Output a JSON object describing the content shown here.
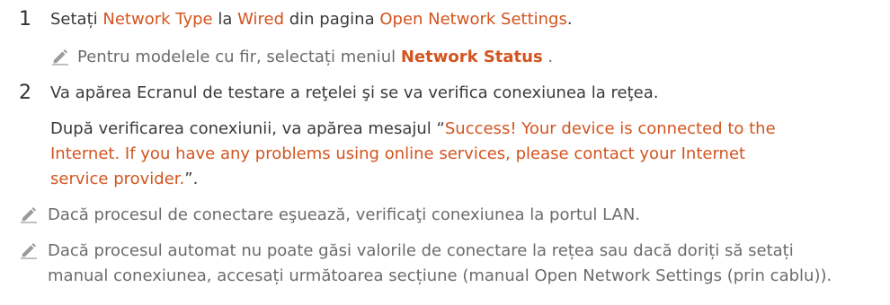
{
  "step1": {
    "number": "1",
    "t1": "Setați ",
    "network_type": "Network Type",
    "t2": " la ",
    "wired": "Wired",
    "t3": " din pagina ",
    "open_network_settings": "Open Network Settings",
    "t4": "."
  },
  "note1": {
    "t1": "Pentru modelele cu fir, selectați meniul ",
    "network_status": "Network Status",
    "t2": " ."
  },
  "step2": {
    "number": "2",
    "line1": "Va apărea Ecranul de testare a reţelei şi se va verifica conexiunea la reţea.",
    "line2_prefix": "După verificarea conexiunii, va apărea mesajul “",
    "message_part1": "Success! Your device is connected to the",
    "message_part2": "Internet. If you have any problems using online services, please contact your Internet",
    "message_part3": "service provider.",
    "line4_suffix": "”."
  },
  "note2": {
    "text": "Dacă procesul de conectare eşuează, verificaţi conexiunea la portul LAN."
  },
  "note3": {
    "line1": "Dacă procesul automat nu poate găsi valorile de conectare la rețea sau dacă doriți să setați",
    "line2": "manual conexiunea, accesați următoarea secțiune (manual Open Network Settings (prin cablu))."
  },
  "icons": {
    "note_icon": "pencil-note-icon"
  },
  "colors": {
    "accent": "#d2541f",
    "text": "#3a3a3a",
    "note_text": "#6b6b6b"
  }
}
